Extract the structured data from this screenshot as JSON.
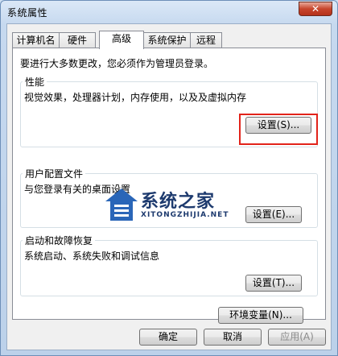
{
  "window": {
    "title": "系统属性",
    "close_label": "✕"
  },
  "tabs": [
    {
      "label": "计算机名"
    },
    {
      "label": "硬件"
    },
    {
      "label": "高级"
    },
    {
      "label": "系统保护"
    },
    {
      "label": "远程"
    }
  ],
  "admin_note": "要进行大多数更改，您必须作为管理员登录。",
  "groups": {
    "performance": {
      "title": "性能",
      "description": "视觉效果，处理器计划，内存使用，以及及虚拟内存",
      "button": "设置(S)..."
    },
    "user_profiles": {
      "title": "用户配置文件",
      "description": "与您登录有关的桌面设置",
      "button": "设置(E)..."
    },
    "startup_recovery": {
      "title": "启动和故障恢复",
      "description": "系统启动、系统失败和调试信息",
      "button": "设置(T)..."
    }
  },
  "env_button": "环境变量(N)...",
  "footer": {
    "ok": "确定",
    "cancel": "取消",
    "apply": "应用(A)"
  },
  "watermark": {
    "title": "系统之家",
    "subtitle": "XITONGZHIJIA.NET"
  },
  "colors": {
    "highlight_box": "#e2231a",
    "close_button": "#c7452c"
  }
}
